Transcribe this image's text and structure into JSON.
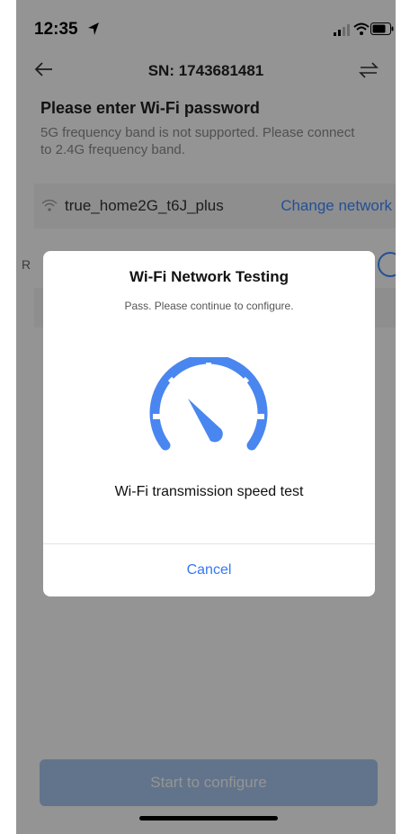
{
  "status_bar": {
    "time": "12:35",
    "icons": [
      "location-arrow-icon",
      "signal-icon",
      "wifi-icon",
      "battery-icon"
    ]
  },
  "nav": {
    "title": "SN: 1743681481",
    "left_icon": "back-arrow-icon",
    "right_icon": "swap-icon"
  },
  "form": {
    "heading": "Please enter Wi-Fi password",
    "subtext": "5G frequency band is not supported. Please connect to 2.4G frequency band.",
    "network_name": "true_home2G_t6J_plus",
    "change_network_label": "Change network",
    "password_label_partial": "R",
    "start_button_label": "Start to configure"
  },
  "dialog": {
    "title": "Wi-Fi Network Testing",
    "subtitle": "Pass. Please continue to configure.",
    "icon": "speedometer-icon",
    "caption": "Wi-Fi transmission speed test",
    "cancel_label": "Cancel"
  },
  "colors": {
    "accent_blue": "#3d8bff",
    "speedometer_blue": "#4a86f0",
    "cancel_blue": "#3478f6",
    "start_button_disabled": "#a8c8f0",
    "overlay": "rgba(0,0,0,0.42)"
  }
}
